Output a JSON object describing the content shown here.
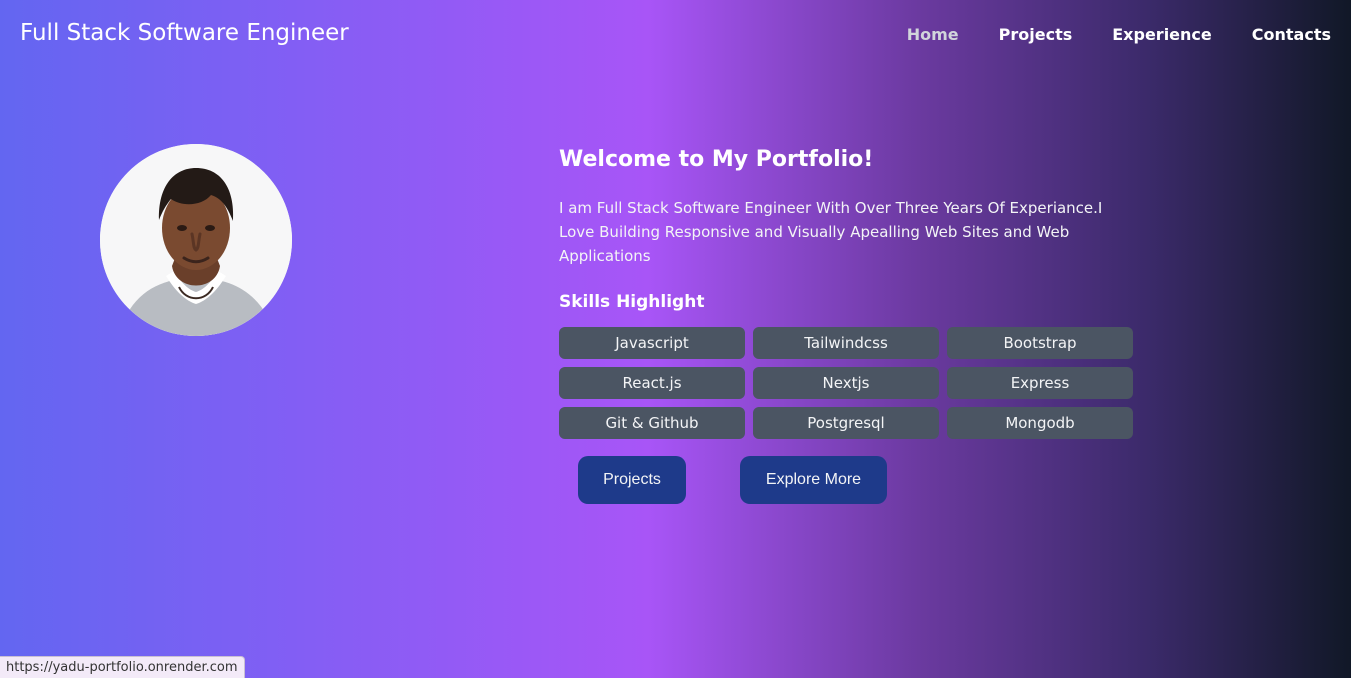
{
  "nav": {
    "brand": "Full Stack Software Engineer",
    "links": [
      {
        "label": "Home",
        "active": true
      },
      {
        "label": "Projects",
        "active": false
      },
      {
        "label": "Experience",
        "active": false
      },
      {
        "label": "Contacts",
        "active": false
      }
    ]
  },
  "hero": {
    "title": "Welcome to My Portfolio!",
    "bio": "I am Full Stack Software Engineer With Over Three Years Of Experiance.I Love Building Responsive and Visually Apealling Web Sites and Web Applications",
    "skills_title": "Skills Highlight",
    "skills": [
      "Javascript",
      "Tailwindcss",
      "Bootstrap",
      "React.js",
      "Nextjs",
      "Express",
      "Git & Github",
      "Postgresql",
      "Mongodb"
    ],
    "buttons": {
      "projects": "Projects",
      "explore": "Explore More"
    }
  },
  "status_bar": {
    "url": "https://yadu-portfolio.onrender.com"
  },
  "colors": {
    "skill_bg": "#4b5563",
    "button_bg": "#1e3a8a",
    "gradient_start": "#6366f1",
    "gradient_mid": "#a855f7",
    "gradient_end": "#111827"
  },
  "icons": {
    "avatar": "profile-photo"
  }
}
